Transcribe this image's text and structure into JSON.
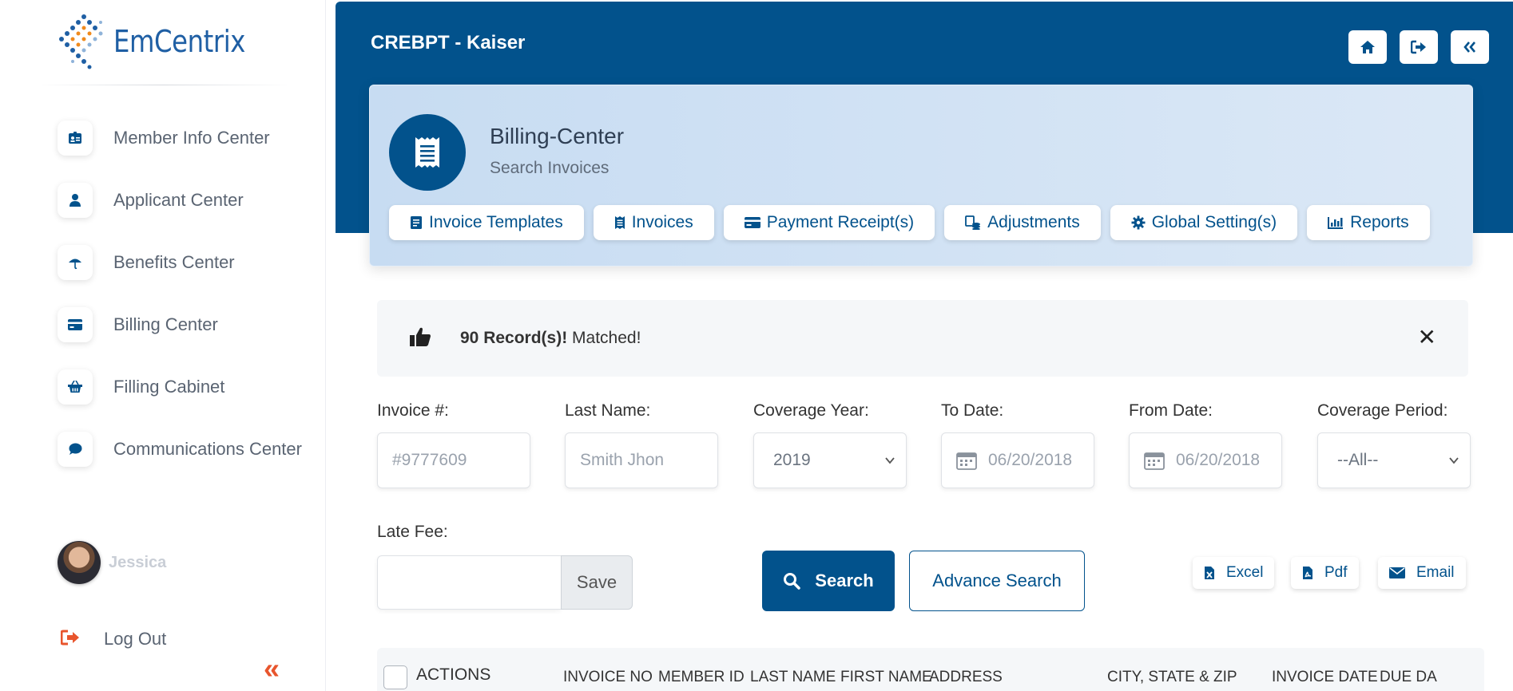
{
  "brand": {
    "logo_text": "EmCentrix"
  },
  "sidebar": {
    "items": [
      {
        "label": "Member Info Center",
        "icon": "id-card-icon"
      },
      {
        "label": "Applicant Center",
        "icon": "user-icon"
      },
      {
        "label": "Benefits Center",
        "icon": "umbrella-icon"
      },
      {
        "label": "Billing Center",
        "icon": "credit-card-icon"
      },
      {
        "label": "Filling Cabinet",
        "icon": "basket-icon"
      },
      {
        "label": "Communications Center",
        "icon": "chat-bubble-icon"
      }
    ],
    "user_name": "Jessica",
    "logout_label": "Log Out",
    "collapse_glyph": "«"
  },
  "header": {
    "title": "CREBPT - Kaiser"
  },
  "section": {
    "title": "Billing-Center",
    "subtitle": "Search Invoices",
    "tabs": [
      {
        "label": "Invoice Templates",
        "icon": "invoice-template-icon"
      },
      {
        "label": "Invoices",
        "icon": "invoice-icon"
      },
      {
        "label": "Payment Receipt(s)",
        "icon": "credit-card-icon"
      },
      {
        "label": "Adjustments",
        "icon": "adjustments-icon"
      },
      {
        "label": "Global Setting(s)",
        "icon": "gear-icon"
      },
      {
        "label": "Reports",
        "icon": "bar-chart-icon"
      }
    ]
  },
  "alert": {
    "count_text": "90 Record(s)!",
    "message": " Matched!",
    "close_glyph": "✕"
  },
  "filters": {
    "invoice_label": "Invoice #:",
    "invoice_placeholder": "#9777609",
    "lastname_label": "Last Name:",
    "lastname_placeholder": "Smith Jhon",
    "year_label": "Coverage Year:",
    "year_value": "2019",
    "todate_label": "To Date:",
    "todate_value": "06/20/2018",
    "fromdate_label": "From Date:",
    "fromdate_value": "06/20/2018",
    "period_label": "Coverage Period:",
    "period_value": "--All--",
    "latefee_label": "Late Fee:",
    "latefee_value": "",
    "save_label": "Save"
  },
  "actions": {
    "search_label": "Search",
    "advance_label": "Advance Search",
    "excel_label": "Excel",
    "pdf_label": "Pdf",
    "email_label": "Email"
  },
  "table": {
    "actions_header": "ACTIONS",
    "columns": [
      "INVOICE NO",
      "MEMBER ID",
      "LAST NAME",
      "FIRST NAME",
      "ADDRESS",
      "CITY, STATE & ZIP",
      "INVOICE DATE",
      "DUE DA"
    ]
  },
  "colors": {
    "primary": "#02528c",
    "accent": "#e8552d",
    "card_bg": "#c7dcf2"
  }
}
